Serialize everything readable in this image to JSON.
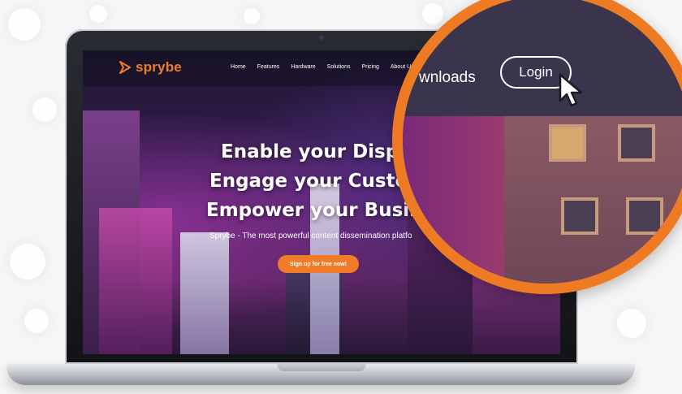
{
  "brand": {
    "name": "sprybe",
    "accent": "#f07c2a"
  },
  "nav": {
    "items": [
      "Home",
      "Features",
      "Hardware",
      "Solutions",
      "Pricing",
      "About Us"
    ]
  },
  "hero": {
    "headline": [
      "Enable your Displa",
      "Engage your Custom",
      "Empower your Busin"
    ],
    "subtitle": "Sprybe - The most powerful content dissemination platfo",
    "cta_label": "Sign up for free now!"
  },
  "magnifier": {
    "downloads_fragment": "wnloads",
    "login_label": "Login",
    "ring_color": "#ef7a24"
  },
  "icons": {
    "logo": "sprybe-logo-icon",
    "cursor": "mouse-pointer-icon"
  }
}
